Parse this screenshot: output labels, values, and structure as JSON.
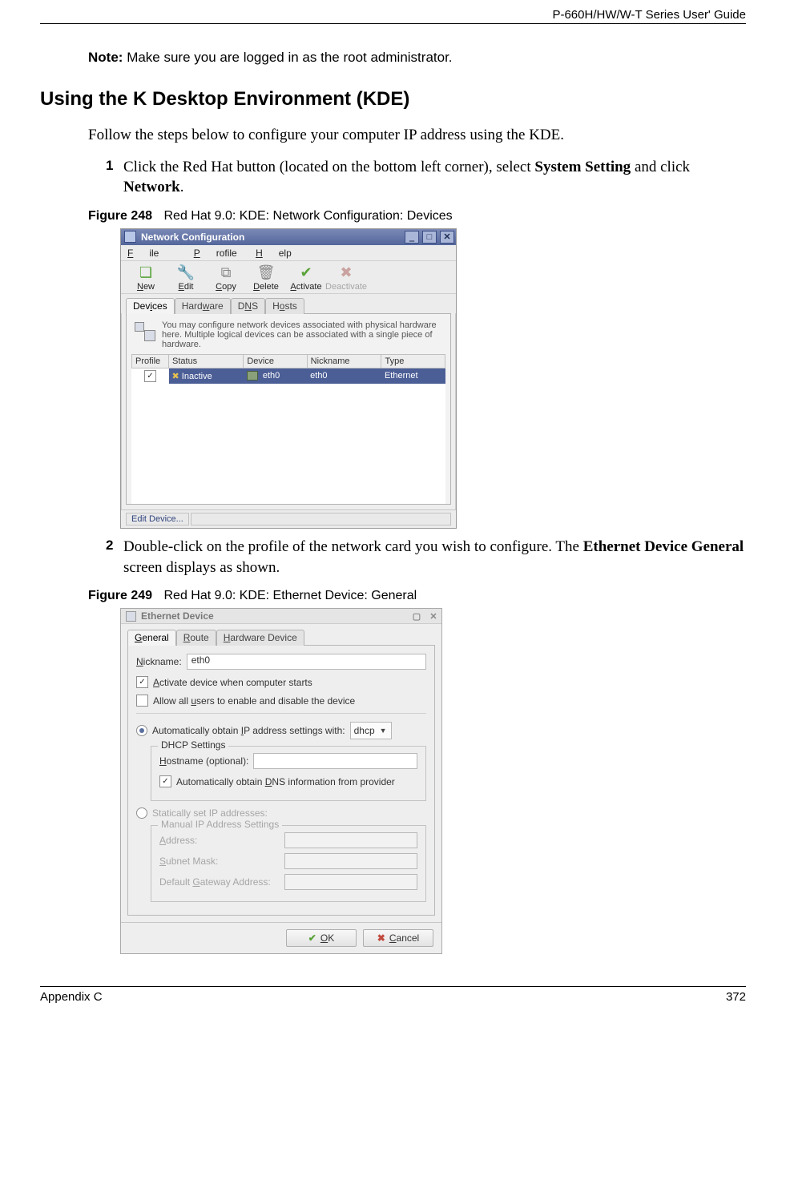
{
  "header": {
    "guide_title": "P-660H/HW/W-T Series User' Guide"
  },
  "note": {
    "label": "Note:",
    "text": "Make sure you are logged in as the root administrator."
  },
  "section_heading": "Using the K Desktop Environment (KDE)",
  "intro_text": "Follow the steps below to configure your computer IP address using the KDE.",
  "steps": {
    "s1": {
      "num": "1",
      "before": "Click the Red Hat button (located on the bottom left corner), select ",
      "bold1": "System Setting",
      "mid": " and click ",
      "bold2": "Network",
      "after": "."
    },
    "s2": {
      "num": "2",
      "before": "Double-click on the profile of the network card you wish to configure. The ",
      "bold1": "Ethernet Device General",
      "after": " screen displays as shown."
    }
  },
  "figure248": {
    "label": "Figure 248",
    "caption": "Red Hat 9.0: KDE: Network Configuration: Devices"
  },
  "figure249": {
    "label": "Figure 249",
    "caption": "Red Hat 9.0: KDE: Ethernet Device: General"
  },
  "win1": {
    "title": "Network Configuration",
    "menu": {
      "file": "File",
      "profile": "Profile",
      "help": "Help"
    },
    "toolbar": {
      "new": "New",
      "edit": "Edit",
      "copy": "Copy",
      "delete": "Delete",
      "activate": "Activate",
      "deactivate": "Deactivate"
    },
    "tabs": {
      "devices": "Devices",
      "hardware": "Hardware",
      "dns": "DNS",
      "hosts": "Hosts"
    },
    "info_text": "You may configure network devices associated with physical hardware here.  Multiple logical devices can be associated with a single piece of hardware.",
    "columns": {
      "profile": "Profile",
      "status": "Status",
      "device": "Device",
      "nickname": "Nickname",
      "type": "Type"
    },
    "row": {
      "profile_check": "✓",
      "status": "Inactive",
      "device": "eth0",
      "nickname": "eth0",
      "type": "Ethernet"
    },
    "status_bar": "Edit Device..."
  },
  "win2": {
    "title": "Ethernet Device",
    "tabs": {
      "general": "General",
      "route": "Route",
      "hardware": "Hardware Device"
    },
    "nickname_label": "Nickname:",
    "nickname_value": "eth0",
    "chk_activate": "Activate device when computer starts",
    "chk_allow": "Allow all users to enable and disable the device",
    "radio_auto": "Automatically obtain IP address settings with:",
    "dhcp_value": "dhcp",
    "dhcp_legend": "DHCP Settings",
    "hostname_label": "Hostname (optional):",
    "chk_dns": "Automatically obtain DNS information from provider",
    "radio_static": "Statically set IP addresses:",
    "static_legend": "Manual IP Address Settings",
    "addr_label": "Address:",
    "subnet_label": "Subnet Mask:",
    "gateway_label": "Default Gateway Address:",
    "ok": "OK",
    "cancel": "Cancel"
  },
  "footer": {
    "left": "Appendix C",
    "right": "372"
  }
}
